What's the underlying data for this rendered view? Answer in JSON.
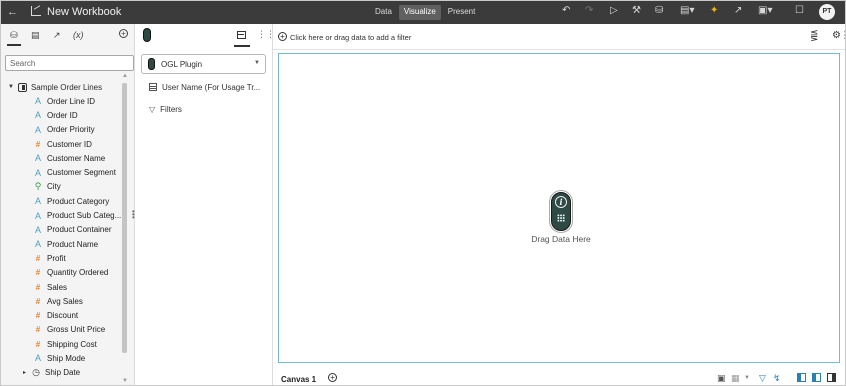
{
  "app": {
    "title": "New Workbook",
    "user_initials": "PT"
  },
  "modes": [
    {
      "label": "Data",
      "active": false
    },
    {
      "label": "Visualize",
      "active": true
    },
    {
      "label": "Present",
      "active": false
    }
  ],
  "data_panel": {
    "search_placeholder": "Search",
    "source_name": "Sample Order Lines",
    "columns": [
      {
        "label": "Order Line ID",
        "type": "attribute",
        "icon": "A"
      },
      {
        "label": "Order ID",
        "type": "attribute",
        "icon": "A"
      },
      {
        "label": "Order Priority",
        "type": "attribute",
        "icon": "A"
      },
      {
        "label": "Customer ID",
        "type": "measure",
        "icon": "#"
      },
      {
        "label": "Customer Name",
        "type": "attribute",
        "icon": "A"
      },
      {
        "label": "Customer Segment",
        "type": "attribute",
        "icon": "A"
      },
      {
        "label": "City",
        "type": "geo",
        "icon": "⚲"
      },
      {
        "label": "Product Category",
        "type": "attribute",
        "icon": "A"
      },
      {
        "label": "Product Sub Categ...",
        "type": "attribute",
        "icon": "A"
      },
      {
        "label": "Product Container",
        "type": "attribute",
        "icon": "A"
      },
      {
        "label": "Product Name",
        "type": "attribute",
        "icon": "A"
      },
      {
        "label": "Profit",
        "type": "measure",
        "icon": "#"
      },
      {
        "label": "Quantity Ordered",
        "type": "measure",
        "icon": "#"
      },
      {
        "label": "Sales",
        "type": "measure",
        "icon": "#"
      },
      {
        "label": "Avg Sales",
        "type": "measure",
        "icon": "#"
      },
      {
        "label": "Discount",
        "type": "measure",
        "icon": "#"
      },
      {
        "label": "Gross Unit Price",
        "type": "measure",
        "icon": "#"
      },
      {
        "label": "Shipping Cost",
        "type": "measure",
        "icon": "#"
      },
      {
        "label": "Ship Mode",
        "type": "attribute",
        "icon": "A"
      },
      {
        "label": "Ship Date",
        "type": "date",
        "icon": "◷",
        "expandable": true
      }
    ]
  },
  "grammar_panel": {
    "viz_type": "OGL Plugin",
    "rows": [
      "User Name (For Usage Tr...",
      "Filters"
    ]
  },
  "filter_bar": {
    "hint": "Click here or drag data to add a filter"
  },
  "canvas": {
    "drop_label": "Drag Data Here",
    "tab_label": "Canvas 1"
  },
  "colors": {
    "topbar_bg": "#3b3b3b",
    "attribute": "#4f9ec0",
    "measure": "#e0832f",
    "geo": "#3c9a49",
    "plugin": "#2e4a45",
    "canvas_border": "#73b9d8"
  }
}
